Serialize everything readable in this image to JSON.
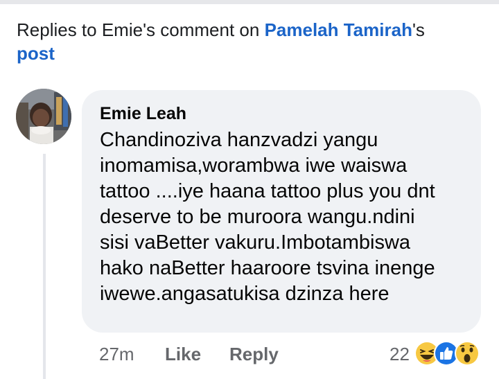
{
  "header": {
    "prefix": "Replies to Emie's comment on ",
    "name_link": "Pamelah Tamirah",
    "suffix": "'s",
    "post_link": "post"
  },
  "comment": {
    "author": "Emie Leah",
    "text": "Chandinoziva hanzvadzi yangu\ninomamisa,worambwa iwe waiswa\ntattoo ....iye haana tattoo plus you dnt\ndeserve to be muroora wangu.ndini\nsisi vaBetter vakuru.Imbotambiswa\nhako naBetter haaroore tsvina inenge\niwewe.angasatukisa dzinza here",
    "time": "27m",
    "like_label": "Like",
    "reply_label": "Reply",
    "reaction_count": "22",
    "reactions": [
      "haha-icon",
      "like-icon",
      "wow-icon"
    ]
  },
  "colors": {
    "link": "#1b64c8",
    "bubble": "#f0f2f5",
    "meta": "#65676b"
  }
}
